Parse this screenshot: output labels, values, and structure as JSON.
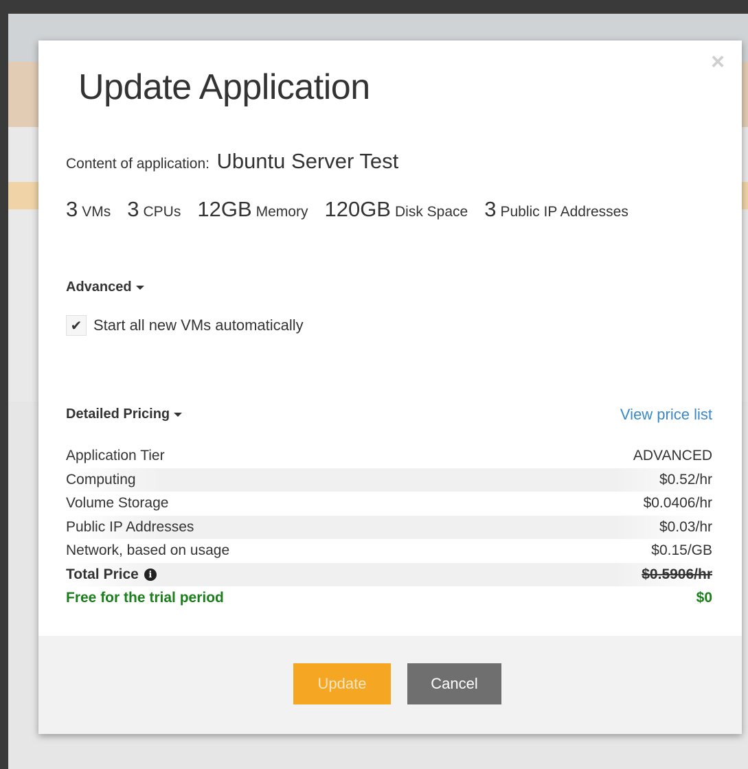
{
  "modal": {
    "title": "Update Application",
    "close_glyph": "×",
    "content_label": "Content of application:",
    "app_name": "Ubuntu Server Test"
  },
  "resources": [
    {
      "value": "3",
      "unit": "VMs"
    },
    {
      "value": "3",
      "unit": "CPUs"
    },
    {
      "value": "12GB",
      "unit": "Memory"
    },
    {
      "value": "120GB",
      "unit": "Disk Space"
    },
    {
      "value": "3",
      "unit": "Public IP Addresses"
    }
  ],
  "advanced": {
    "label": "Advanced",
    "checkbox_label": "Start all new VMs automatically",
    "checkbox_checked": true,
    "check_glyph": "✔"
  },
  "pricing": {
    "label": "Detailed Pricing",
    "view_price_list": "View price list",
    "rows": [
      {
        "label": "Application Tier",
        "value": "ADVANCED"
      },
      {
        "label": "Computing",
        "value": "$0.52/hr"
      },
      {
        "label": "Volume Storage",
        "value": "$0.0406/hr"
      },
      {
        "label": "Public IP Addresses",
        "value": "$0.03/hr"
      },
      {
        "label": "Network, based on usage",
        "value": "$0.15/GB"
      }
    ],
    "total_label": "Total Price",
    "total_value": "$0.5906/hr",
    "info_glyph": "i",
    "trial_label": "Free for the trial period",
    "trial_value": "$0"
  },
  "footer": {
    "update_label": "Update",
    "cancel_label": "Cancel"
  },
  "colors": {
    "update_button": "#f5a623",
    "cancel_button": "#6f6f6f",
    "link": "#3a87c9",
    "trial_text": "#1a7f1a"
  }
}
